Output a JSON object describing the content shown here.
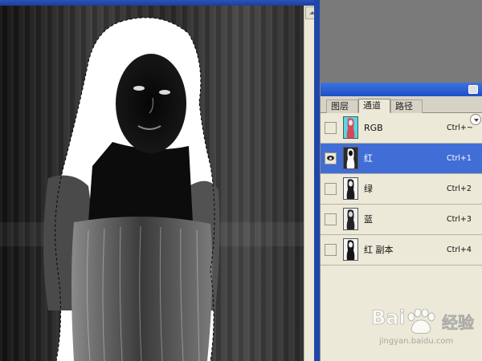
{
  "palette": {
    "tabs": [
      {
        "label": "图层",
        "active": false
      },
      {
        "label": "通道",
        "active": true
      },
      {
        "label": "路径",
        "active": false
      }
    ],
    "channels": [
      {
        "name": "RGB",
        "shortcut": "Ctrl+~",
        "visible": false,
        "selected": false,
        "thumb": "rgb"
      },
      {
        "name": "红",
        "shortcut": "Ctrl+1",
        "visible": true,
        "selected": true,
        "thumb": "red"
      },
      {
        "name": "绿",
        "shortcut": "Ctrl+2",
        "visible": false,
        "selected": false,
        "thumb": "gray"
      },
      {
        "name": "蓝",
        "shortcut": "Ctrl+3",
        "visible": false,
        "selected": false,
        "thumb": "gray"
      },
      {
        "name": "红 副本",
        "shortcut": "Ctrl+4",
        "visible": false,
        "selected": false,
        "thumb": "mask"
      }
    ],
    "selected_color": "#416ed6",
    "titlebar_color": "#2b5bd3"
  },
  "watermark": {
    "brand_left": "Bai",
    "brand_right": "经验",
    "url": "jingyan.baidu.com"
  }
}
